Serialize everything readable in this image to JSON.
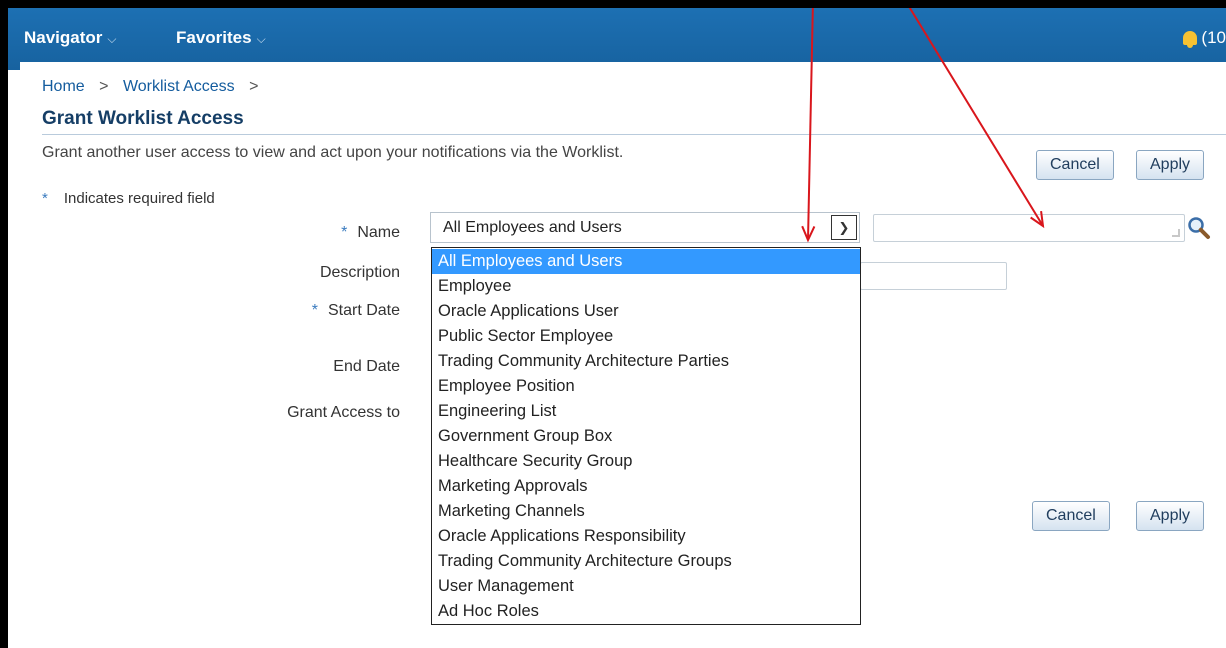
{
  "nav": {
    "navigator": "Navigator",
    "favorites": "Favorites",
    "notifications": "(10"
  },
  "breadcrumb": {
    "home": "Home",
    "worklist_access": "Worklist Access",
    "separator": ">"
  },
  "page": {
    "title": "Grant Worklist Access",
    "instruction": "Grant another user access to view and act upon your notifications via the Worklist.",
    "required_note": "Indicates required field",
    "required_marker": "*"
  },
  "buttons": {
    "cancel": "Cancel",
    "apply": "Apply"
  },
  "form": {
    "name_label": "Name",
    "description_label": "Description",
    "start_date_label": "Start Date",
    "end_date_label": "End Date",
    "grant_access_label": "Grant Access to",
    "name_select_value": "All Employees and Users",
    "dropdown_options": [
      "All Employees and Users",
      "Employee",
      "Oracle Applications User",
      "Public Sector Employee",
      "Trading Community Architecture Parties",
      "Employee Position",
      "Engineering List",
      "Government Group Box",
      "Healthcare Security Group",
      "Marketing Approvals",
      "Marketing Channels",
      "Oracle Applications Responsibility",
      "Trading Community Architecture Groups",
      "User Management",
      "Ad Hoc Roles"
    ],
    "selected_option_index": 0
  },
  "colors": {
    "header_blue": "#1d70b3",
    "selected_option": "#3399ff",
    "annotation_arrow": "#d9161c"
  },
  "icons": {
    "notification": "bell-icon",
    "lov_search": "search-icon",
    "select_toggle": "chevron-down-icon"
  }
}
